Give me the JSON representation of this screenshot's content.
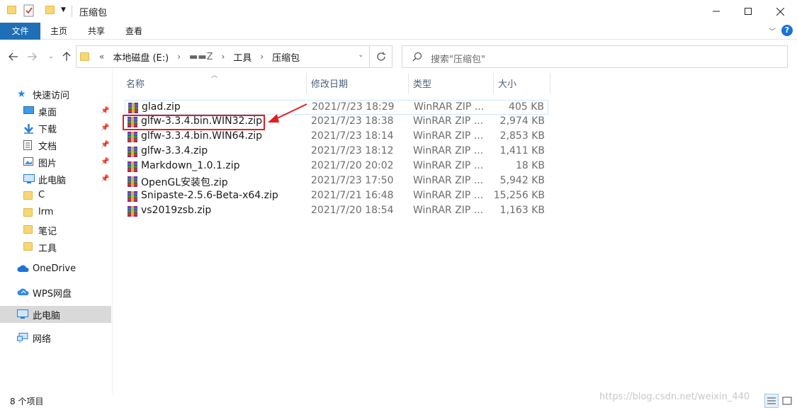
{
  "window": {
    "title": "压缩包"
  },
  "ribbon": {
    "tabs": [
      "文件",
      "主页",
      "共享",
      "查看"
    ],
    "help_label": "?"
  },
  "address": {
    "prefix": "«",
    "crumbs": [
      "本地磁盘 (E:)",
      "▬▬Z",
      "工具",
      "压缩包"
    ]
  },
  "search": {
    "placeholder": "搜索\"压缩包\""
  },
  "sidebar": {
    "quick_access": "快速访问",
    "items": [
      {
        "label": "桌面",
        "icon": "desktop-icon",
        "pinned": true
      },
      {
        "label": "下载",
        "icon": "download-icon",
        "pinned": true
      },
      {
        "label": "文档",
        "icon": "document-icon",
        "pinned": true
      },
      {
        "label": "图片",
        "icon": "picture-icon",
        "pinned": true
      },
      {
        "label": "此电脑",
        "icon": "computer-icon",
        "pinned": true
      },
      {
        "label": "C",
        "icon": "folder-icon",
        "pinned": false
      },
      {
        "label": "lrm",
        "icon": "folder-icon",
        "pinned": false
      },
      {
        "label": "笔记",
        "icon": "folder-icon",
        "pinned": false
      },
      {
        "label": "工具",
        "icon": "folder-icon",
        "pinned": false
      }
    ],
    "roots": [
      {
        "label": "OneDrive",
        "icon": "cloud-icon"
      },
      {
        "label": "WPS网盘",
        "icon": "wps-cloud-icon"
      },
      {
        "label": "此电脑",
        "icon": "computer-icon"
      },
      {
        "label": "网络",
        "icon": "network-icon"
      }
    ]
  },
  "columns": [
    "名称",
    "修改日期",
    "类型",
    "大小"
  ],
  "files": [
    {
      "name": "glad.zip",
      "date": "2021/7/23 18:29",
      "type": "WinRAR ZIP ...",
      "size": "405 KB"
    },
    {
      "name": "glfw-3.3.4.bin.WIN32.zip",
      "date": "2021/7/23 18:38",
      "type": "WinRAR ZIP ...",
      "size": "2,974 KB"
    },
    {
      "name": "glfw-3.3.4.bin.WIN64.zip",
      "date": "2021/7/23 18:14",
      "type": "WinRAR ZIP ...",
      "size": "2,853 KB"
    },
    {
      "name": "glfw-3.3.4.zip",
      "date": "2021/7/23 18:12",
      "type": "WinRAR ZIP ...",
      "size": "1,411 KB"
    },
    {
      "name": "Markdown_1.0.1.zip",
      "date": "2021/7/20 20:02",
      "type": "WinRAR ZIP ...",
      "size": "18 KB"
    },
    {
      "name": "OpenGL安装包.zip",
      "date": "2021/7/23 17:50",
      "type": "WinRAR ZIP ...",
      "size": "5,942 KB"
    },
    {
      "name": "Snipaste-2.5.6-Beta-x64.zip",
      "date": "2021/7/21 16:48",
      "type": "WinRAR ZIP ...",
      "size": "15,256 KB"
    },
    {
      "name": "vs2019zsb.zip",
      "date": "2021/7/20 18:54",
      "type": "WinRAR ZIP ...",
      "size": "1,163 KB"
    }
  ],
  "status": {
    "count": "8 个项目"
  },
  "watermark": "https://blog.csdn.net/weixin_440"
}
